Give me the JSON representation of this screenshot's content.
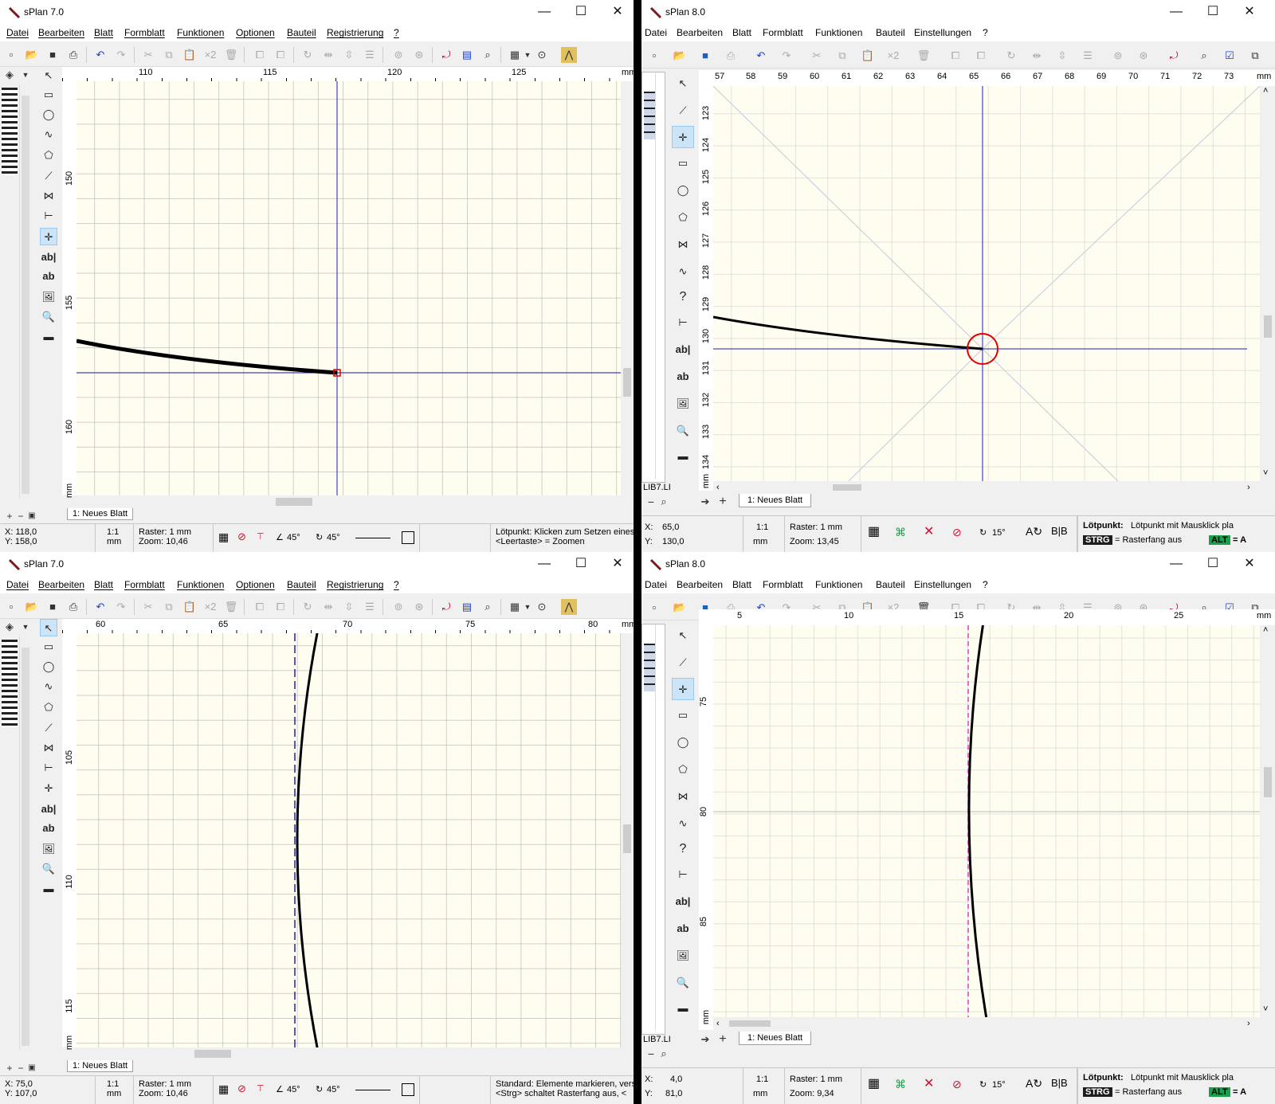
{
  "w1": {
    "title": "sPlan 7.0",
    "menu": [
      "Datei",
      "Bearbeiten",
      "Blatt",
      "Formblatt",
      "Funktionen",
      "Optionen",
      "Bauteil",
      "Registrierung",
      "?"
    ],
    "ruler_x": [
      "110",
      "115",
      "120",
      "125",
      "mm"
    ],
    "ruler_y": [
      "150",
      "155",
      "160",
      "mm"
    ],
    "tab": "1: Neues Blatt",
    "status": {
      "x": "X: 118,0",
      "y": "Y: 158,0",
      "scale": "1:1",
      "scale_unit": "mm",
      "raster": "Raster: 1 mm",
      "zoom": "Zoom:   10,46",
      "angle1": "45°",
      "angle2": "45°",
      "hint1": "Lötpunkt: Klicken zum Setzen eines",
      "hint2": "<Leertaste> = Zoomen"
    }
  },
  "w2": {
    "title": "sPlan 8.0",
    "menu": [
      "Datei",
      "Bearbeiten",
      "Blatt",
      "Formblatt",
      "Funktionen",
      "Bauteil",
      "Einstellungen",
      "?"
    ],
    "ruler_x": [
      "57",
      "58",
      "59",
      "60",
      "61",
      "62",
      "63",
      "64",
      "65",
      "66",
      "67",
      "68",
      "69",
      "70",
      "71",
      "72",
      "73",
      "mm"
    ],
    "ruler_y": [
      "123",
      "124",
      "125",
      "126",
      "127",
      "128",
      "129",
      "130",
      "131",
      "132",
      "133",
      "134",
      "mm"
    ],
    "lib": "LIB7.LI",
    "tab": "1: Neues Blatt",
    "status": {
      "x_label": "X:",
      "x": "65,0",
      "y_label": "Y:",
      "y": "130,0",
      "scale": "1:1",
      "scale_unit": "mm",
      "raster": "Raster: 1 mm",
      "zoom": "Zoom: 13,45",
      "angle": "15°",
      "hint_bold": "Lötpunkt:",
      "hint": "Lötpunkt mit Mausklick pla",
      "strg": "STRG",
      "strg_text": "= Rasterfang aus",
      "alt": "ALT",
      "alt_text": "= A"
    }
  },
  "w3": {
    "title": "sPlan 7.0",
    "menu": [
      "Datei",
      "Bearbeiten",
      "Blatt",
      "Formblatt",
      "Funktionen",
      "Optionen",
      "Bauteil",
      "Registrierung",
      "?"
    ],
    "ruler_x": [
      "60",
      "65",
      "70",
      "75",
      "80",
      "mm"
    ],
    "ruler_y": [
      "105",
      "110",
      "115",
      "mm"
    ],
    "tab": "1: Neues Blatt",
    "status": {
      "x": "X: 75,0",
      "y": "Y: 107,0",
      "scale": "1:1",
      "scale_unit": "mm",
      "raster": "Raster: 1 mm",
      "zoom": "Zoom:   10,46",
      "angle1": "45°",
      "angle2": "45°",
      "hint1": "Standard: Elemente markieren, vers",
      "hint2": "<Strg> schaltet Rasterfang aus, <"
    }
  },
  "w4": {
    "title": "sPlan 8.0",
    "menu": [
      "Datei",
      "Bearbeiten",
      "Blatt",
      "Formblatt",
      "Funktionen",
      "Bauteil",
      "Einstellungen",
      "?"
    ],
    "ruler_x": [
      "5",
      "10",
      "15",
      "20",
      "25",
      "mm"
    ],
    "ruler_y": [
      "75",
      "80",
      "85",
      "mm"
    ],
    "lib": "LIB7.LI",
    "tab": "1: Neues Blatt",
    "status": {
      "x_label": "X:",
      "x": "4,0",
      "y_label": "Y:",
      "y": "81,0",
      "scale": "1:1",
      "scale_unit": "mm",
      "raster": "Raster: 1 mm",
      "zoom": "Zoom: 9,34",
      "angle": "15°",
      "hint_bold": "Lötpunkt:",
      "hint": "Lötpunkt mit Mausklick pla",
      "strg": "STRG",
      "strg_text": "= Rasterfang aus",
      "alt": "ALT",
      "alt_text": "= A"
    }
  },
  "icons": {
    "left_v7": [
      "arrow-icon",
      "rectangle-icon",
      "ellipse-icon",
      "bezier-icon",
      "polygon-icon",
      "line-icon",
      "polyline-icon",
      "dimension-icon",
      "solder-point-icon",
      "text-icon",
      "textbox-icon",
      "image-icon",
      "zoom-icon",
      "ruler-icon"
    ],
    "left_v8": [
      "arrow-icon",
      "line-icon",
      "solder-point-icon",
      "rectangle-icon",
      "ellipse-icon",
      "polygon-icon",
      "polyline-icon",
      "bezier-icon",
      "help-icon",
      "dimension-icon",
      "text-icon",
      "textbox-icon",
      "image-icon",
      "zoom-icon",
      "ruler-icon"
    ]
  },
  "colors": {
    "crosshair": "#1f1fbf",
    "marker": "#e00000",
    "guide_v8": "#e040c0",
    "canvas": "#fefdf0"
  }
}
